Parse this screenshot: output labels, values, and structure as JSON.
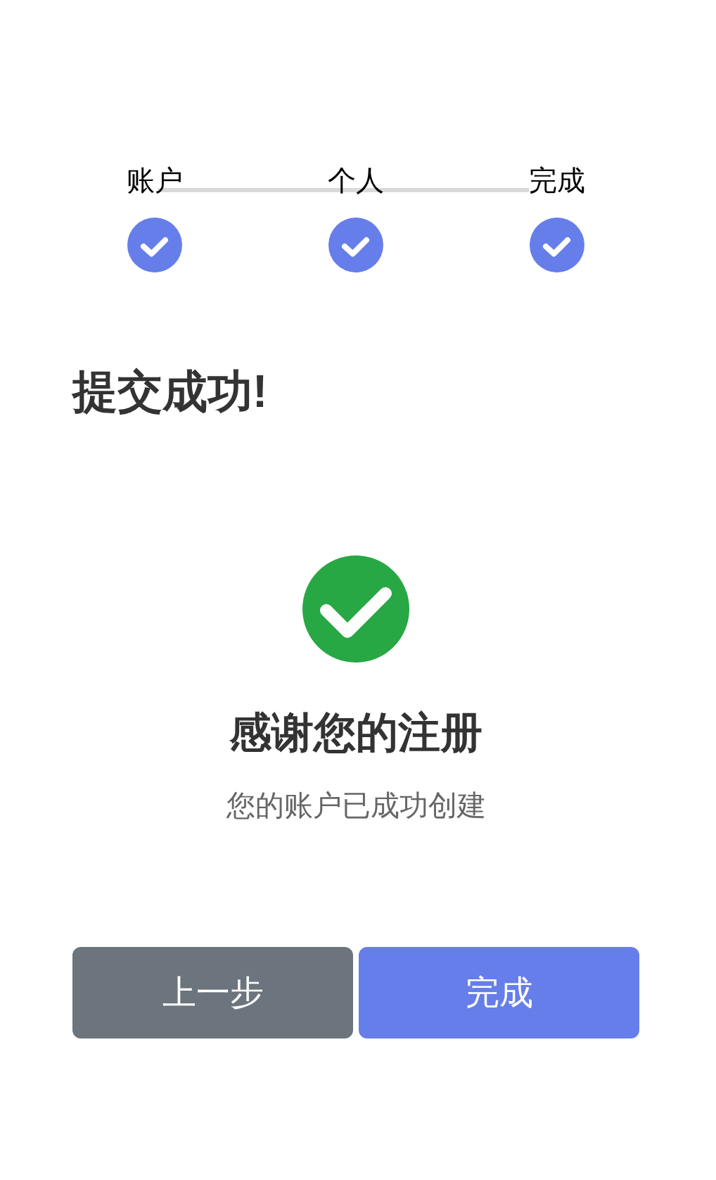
{
  "steps": [
    {
      "label": "账户",
      "completed": true
    },
    {
      "label": "个人",
      "completed": true
    },
    {
      "label": "完成",
      "completed": true
    }
  ],
  "title": "提交成功!",
  "result": {
    "heading": "感谢您的注册",
    "message": "您的账户已成功创建"
  },
  "buttons": [
    {
      "label": "上一步",
      "kind": "secondary"
    },
    {
      "label": "完成",
      "kind": "primary"
    }
  ]
}
